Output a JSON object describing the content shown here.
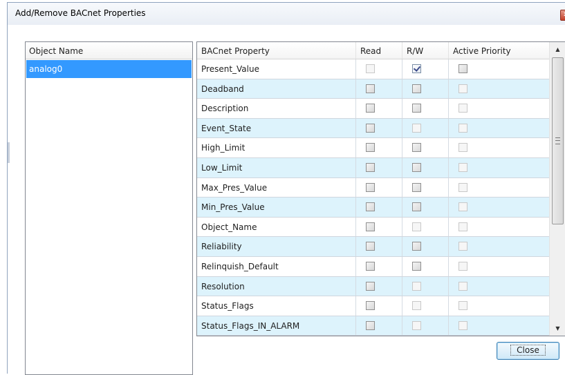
{
  "window": {
    "title": "Add/Remove BACnet Properties",
    "close_glyph": "x"
  },
  "object_list": {
    "header": "Object Name",
    "items": [
      "analog0"
    ],
    "selected": "analog0"
  },
  "property_grid": {
    "columns": [
      "BACnet Property",
      "Read",
      "R/W",
      "Active Priority"
    ],
    "rows": [
      {
        "name": "Present_Value",
        "read": "disabled",
        "rw": "checked",
        "priority": "enabled"
      },
      {
        "name": "Deadband",
        "read": "enabled",
        "rw": "enabled",
        "priority": "disabled"
      },
      {
        "name": "Description",
        "read": "enabled",
        "rw": "enabled",
        "priority": "disabled"
      },
      {
        "name": "Event_State",
        "read": "enabled",
        "rw": "disabled",
        "priority": "disabled"
      },
      {
        "name": "High_Limit",
        "read": "enabled",
        "rw": "enabled",
        "priority": "disabled"
      },
      {
        "name": "Low_Limit",
        "read": "enabled",
        "rw": "enabled",
        "priority": "disabled"
      },
      {
        "name": "Max_Pres_Value",
        "read": "enabled",
        "rw": "enabled",
        "priority": "disabled"
      },
      {
        "name": "Min_Pres_Value",
        "read": "enabled",
        "rw": "enabled",
        "priority": "disabled"
      },
      {
        "name": "Object_Name",
        "read": "enabled",
        "rw": "disabled",
        "priority": "disabled"
      },
      {
        "name": "Reliability",
        "read": "enabled",
        "rw": "enabled",
        "priority": "disabled"
      },
      {
        "name": "Relinquish_Default",
        "read": "enabled",
        "rw": "enabled",
        "priority": "disabled"
      },
      {
        "name": "Resolution",
        "read": "enabled",
        "rw": "disabled",
        "priority": "disabled"
      },
      {
        "name": "Status_Flags",
        "read": "enabled",
        "rw": "disabled",
        "priority": "disabled"
      },
      {
        "name": "Status_Flags_IN_ALARM",
        "read": "enabled",
        "rw": "disabled",
        "priority": "disabled"
      }
    ]
  },
  "scrollbar": {
    "up_glyph": "▲",
    "down_glyph": "▼"
  },
  "buttons": {
    "close_label": "Close"
  }
}
